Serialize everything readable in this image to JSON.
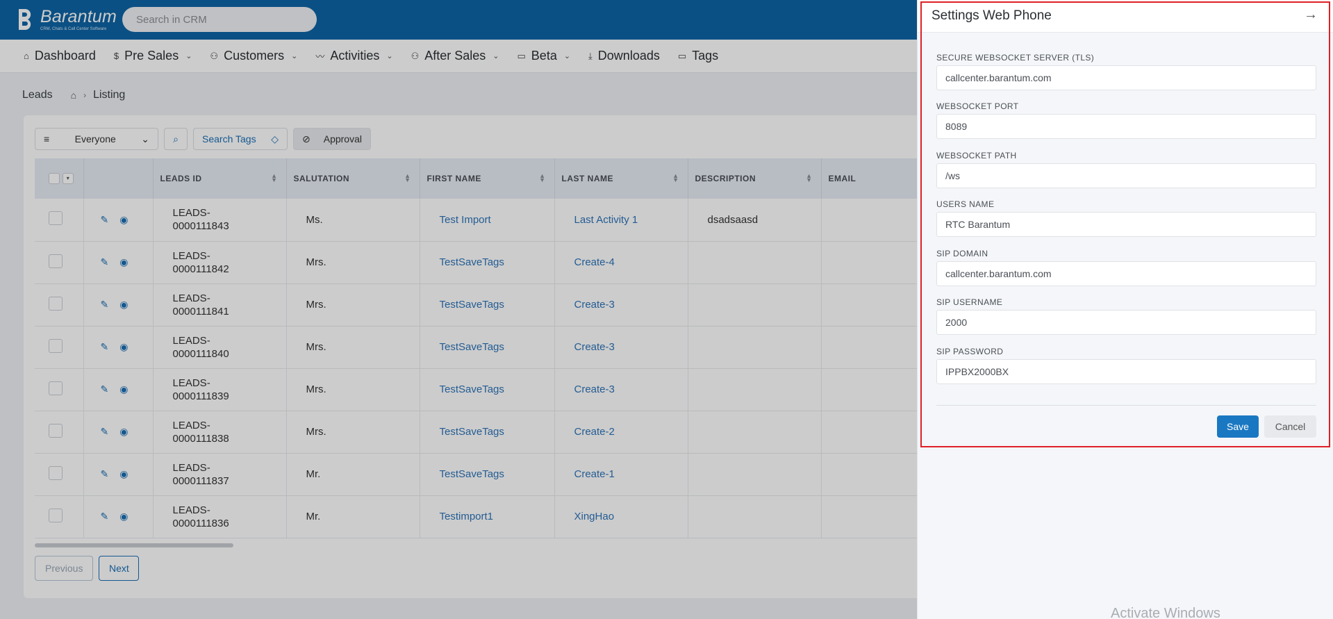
{
  "app": {
    "logo_name": "Barantum",
    "logo_tagline": "CRM, Chats & Call Center Software",
    "search_placeholder": "Search in CRM"
  },
  "nav": [
    {
      "label": "Dashboard",
      "icon": "home-icon",
      "has_dropdown": false
    },
    {
      "label": "Pre Sales",
      "icon": "dollar-icon",
      "has_dropdown": true
    },
    {
      "label": "Customers",
      "icon": "users-icon",
      "has_dropdown": true
    },
    {
      "label": "Activities",
      "icon": "activity-icon",
      "has_dropdown": true
    },
    {
      "label": "After Sales",
      "icon": "users-icon",
      "has_dropdown": true
    },
    {
      "label": "Beta",
      "icon": "folder-icon",
      "has_dropdown": true
    },
    {
      "label": "Downloads",
      "icon": "download-icon",
      "has_dropdown": false
    },
    {
      "label": "Tags",
      "icon": "folder-icon",
      "has_dropdown": false
    }
  ],
  "breadcrumb": {
    "module": "Leads",
    "current": "Listing"
  },
  "filters": {
    "owner": "Everyone",
    "tags_placeholder": "Search Tags",
    "approval": "Approval"
  },
  "table": {
    "columns": [
      "LEADS ID",
      "SALUTATION",
      "FIRST NAME",
      "LAST NAME",
      "DESCRIPTION",
      "EMAIL"
    ],
    "rows": [
      {
        "id_a": "LEADS-",
        "id_b": "0000111843",
        "salutation": "Ms.",
        "first_name": "Test Import",
        "last_name": "Last Activity 1",
        "description": "dsadsaasd",
        "email": ""
      },
      {
        "id_a": "LEADS-",
        "id_b": "0000111842",
        "salutation": "Mrs.",
        "first_name": "TestSaveTags",
        "last_name": "Create-4",
        "description": "",
        "email": ""
      },
      {
        "id_a": "LEADS-",
        "id_b": "0000111841",
        "salutation": "Mrs.",
        "first_name": "TestSaveTags",
        "last_name": "Create-3",
        "description": "",
        "email": ""
      },
      {
        "id_a": "LEADS-",
        "id_b": "0000111840",
        "salutation": "Mrs.",
        "first_name": "TestSaveTags",
        "last_name": "Create-3",
        "description": "",
        "email": ""
      },
      {
        "id_a": "LEADS-",
        "id_b": "0000111839",
        "salutation": "Mrs.",
        "first_name": "TestSaveTags",
        "last_name": "Create-3",
        "description": "",
        "email": ""
      },
      {
        "id_a": "LEADS-",
        "id_b": "0000111838",
        "salutation": "Mrs.",
        "first_name": "TestSaveTags",
        "last_name": "Create-2",
        "description": "",
        "email": ""
      },
      {
        "id_a": "LEADS-",
        "id_b": "0000111837",
        "salutation": "Mr.",
        "first_name": "TestSaveTags",
        "last_name": "Create-1",
        "description": "",
        "email": ""
      },
      {
        "id_a": "LEADS-",
        "id_b": "0000111836",
        "salutation": "Mr.",
        "first_name": "Testimport1",
        "last_name": "XingHao",
        "description": "",
        "email": ""
      }
    ]
  },
  "pagination": {
    "previous": "Previous",
    "next": "Next"
  },
  "panel": {
    "title": "Settings Web Phone",
    "fields": [
      {
        "label": "SECURE WEBSOCKET SERVER (TLS)",
        "value": "callcenter.barantum.com"
      },
      {
        "label": "WEBSOCKET PORT",
        "value": "8089"
      },
      {
        "label": "WEBSOCKET PATH",
        "value": "/ws"
      },
      {
        "label": "USERS NAME",
        "value": "RTC Barantum"
      },
      {
        "label": "SIP DOMAIN",
        "value": "callcenter.barantum.com"
      },
      {
        "label": "SIP USERNAME",
        "value": "2000"
      },
      {
        "label": "SIP PASSWORD",
        "value": "IPPBX2000BX"
      }
    ],
    "save": "Save",
    "cancel": "Cancel"
  },
  "watermark": "Activate Windows",
  "colors": {
    "header": "#0e65a5",
    "accent": "#1a78c2",
    "highlight": "#e01f26"
  }
}
